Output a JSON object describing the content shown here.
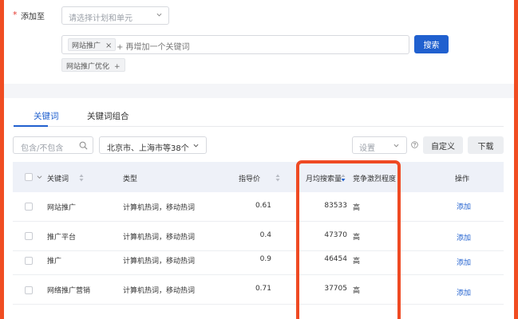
{
  "form": {
    "required_mark": "*",
    "add_to_label": "添加至",
    "plan_select_placeholder": "请选择计划和单元",
    "keyword_tag": "网站推广",
    "keyword_input_placeholder": "+ 再增加一个关键词",
    "search_button": "搜索",
    "suggestion_tag": "网站推广优化",
    "suggestion_plus": "+"
  },
  "tabs": [
    {
      "label": "关键词",
      "active": true
    },
    {
      "label": "关键词组合",
      "active": false
    }
  ],
  "toolbar": {
    "filter_placeholder": "包含/不包含",
    "region_value": "北京市、上海市等38个",
    "settings_placeholder": "设置",
    "custom_button": "自定义",
    "download_button": "下载"
  },
  "table": {
    "columns": {
      "keyword": "关键词",
      "type": "类型",
      "guide_price": "指导价",
      "monthly_search": "月均搜索量",
      "competition": "竞争激烈程度",
      "action": "操作"
    },
    "rows": [
      {
        "keyword": "网站推广",
        "type": "计算机热词，移动热词",
        "price": "0.61",
        "search": "83533",
        "competition": "高",
        "action": "添加"
      },
      {
        "keyword": "推广平台",
        "type": "计算机热词，移动热词",
        "price": "0.4",
        "search": "47370",
        "competition": "高",
        "action": "添加"
      },
      {
        "keyword": "推广",
        "type": "计算机热词，移动热词",
        "price": "0.9",
        "search": "46454",
        "competition": "高",
        "action": "添加"
      },
      {
        "keyword": "网络推广营销",
        "type": "计算机热词，移动热词",
        "price": "0.71",
        "search": "37705",
        "competition": "高",
        "action": "添加"
      }
    ]
  },
  "colors": {
    "accent": "#2060cf",
    "highlight": "#ef4a23",
    "header_bg": "#eef1f8"
  }
}
